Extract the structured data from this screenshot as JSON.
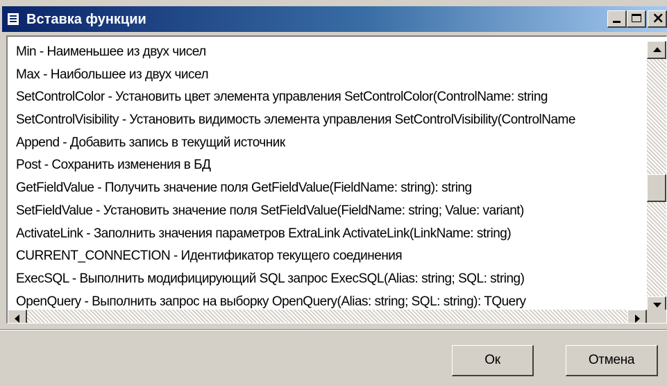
{
  "window": {
    "title": "Вставка функции",
    "icon": "list-document-icon",
    "controls": [
      "minimize-icon",
      "maximize-icon",
      "close-icon"
    ],
    "colors": {
      "titlebar_start": "#0a246a",
      "titlebar_end": "#a6caf0",
      "face": "#d4d0c8",
      "list_background": "#ffffff"
    }
  },
  "functions": [
    {
      "text": "Min  -  Наименьшее из двух чисел"
    },
    {
      "text": "Max  -  Наибольшее из двух чисел"
    },
    {
      "text": "SetControlColor  -  Установить цвет элемента управления SetControlColor(ControlName: string"
    },
    {
      "text": "SetControlVisibility  -  Установить видимость элемента управления SetControlVisibility(ControlName"
    },
    {
      "text": "Append  -  Добавить запись в текущий источник"
    },
    {
      "text": "Post  -  Сохранить изменения в БД"
    },
    {
      "text": "GetFieldValue  -  Получить значение поля  GetFieldValue(FieldName: string): string"
    },
    {
      "text": "SetFieldValue  -  Установить значение поля  SetFieldValue(FieldName: string; Value: variant)"
    },
    {
      "text": "ActivateLink  -  Заполнить значения параметров ExtraLink   ActivateLink(LinkName: string)"
    },
    {
      "text": "CURRENT_CONNECTION  -  Идентификатор текущего соединения"
    },
    {
      "text": "ExecSQL  -  Выполнить  модифицирующий SQL запрос   ExecSQL(Alias: string; SQL: string)"
    },
    {
      "text": "OpenQuery  -  Выполнить запрос на выборку  OpenQuery(Alias: string; SQL: string): TQuery"
    }
  ],
  "scrollbars": {
    "vertical_position": 0.55,
    "horizontal_position": 0.0
  },
  "buttons": {
    "ok": "Ок",
    "cancel": "Отмена"
  }
}
